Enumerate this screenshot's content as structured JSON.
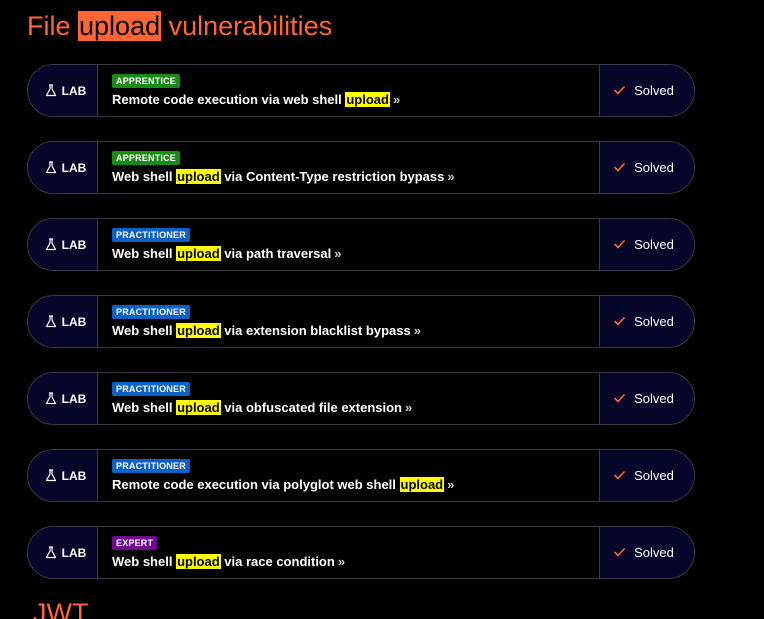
{
  "section": {
    "title_before": "File ",
    "title_highlight": "upload",
    "title_after": " vulnerabilities"
  },
  "next_section": {
    "title": "JWT"
  },
  "colors": {
    "accent": "#ff6633",
    "highlight": "#ffff00",
    "apprentice": "#1b8a13",
    "practitioner": "#0c62c4",
    "expert": "#6a0c8c",
    "panel": "#06062a"
  },
  "labs": [
    {
      "type_label": "LAB",
      "level": "APPRENTICE",
      "level_key": "apprentice",
      "title_before": "Remote code execution via web shell ",
      "title_highlight": "upload",
      "title_after": "",
      "status": "Solved"
    },
    {
      "type_label": "LAB",
      "level": "APPRENTICE",
      "level_key": "apprentice",
      "title_before": "Web shell ",
      "title_highlight": "upload",
      "title_after": " via Content-Type restriction bypass",
      "status": "Solved"
    },
    {
      "type_label": "LAB",
      "level": "PRACTITIONER",
      "level_key": "practitioner",
      "title_before": "Web shell ",
      "title_highlight": "upload",
      "title_after": " via path traversal",
      "status": "Solved"
    },
    {
      "type_label": "LAB",
      "level": "PRACTITIONER",
      "level_key": "practitioner",
      "title_before": "Web shell ",
      "title_highlight": "upload",
      "title_after": " via extension blacklist bypass",
      "status": "Solved"
    },
    {
      "type_label": "LAB",
      "level": "PRACTITIONER",
      "level_key": "practitioner",
      "title_before": "Web shell ",
      "title_highlight": "upload",
      "title_after": " via obfuscated file extension",
      "status": "Solved"
    },
    {
      "type_label": "LAB",
      "level": "PRACTITIONER",
      "level_key": "practitioner",
      "title_before": "Remote code execution via polyglot web shell ",
      "title_highlight": "upload",
      "title_after": "",
      "status": "Solved"
    },
    {
      "type_label": "LAB",
      "level": "EXPERT",
      "level_key": "expert",
      "title_before": "Web shell ",
      "title_highlight": "upload",
      "title_after": " via race condition",
      "status": "Solved"
    }
  ],
  "icons": {
    "lab": "flask-icon",
    "link": "chevron-double-right-icon",
    "status": "check-icon"
  }
}
